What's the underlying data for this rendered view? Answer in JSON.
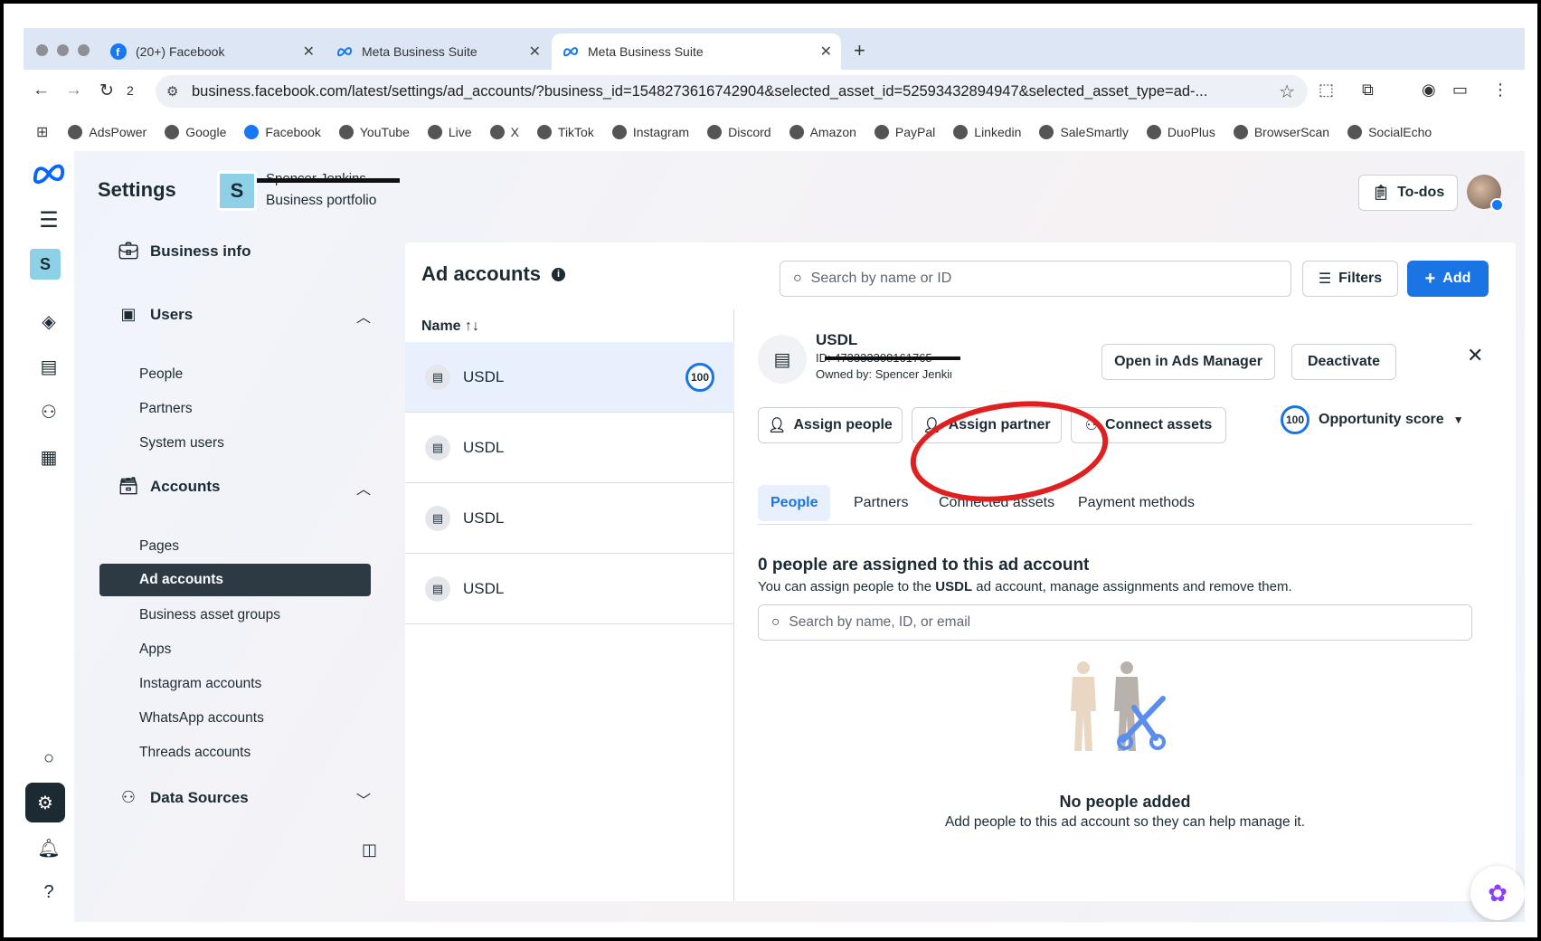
{
  "browser": {
    "tabs": [
      {
        "title": "(20+) Facebook"
      },
      {
        "title": "Meta Business Suite"
      },
      {
        "title": "Meta Business Suite"
      }
    ],
    "reload_count": "2",
    "url": "business.facebook.com/latest/settings/ad_accounts/?business_id=1548273616742904&selected_asset_id=52593432894947&selected_asset_type=ad-...",
    "bookmarks": [
      "AdsPower",
      "Google",
      "Facebook",
      "YouTube",
      "Live",
      "X",
      "TikTok",
      "Instagram",
      "Discord",
      "Amazon",
      "PayPal",
      "Linkedin",
      "SaleSmartly",
      "DuoPlus",
      "BrowserScan",
      "SocialEcho"
    ]
  },
  "header": {
    "title": "Settings",
    "portfolio_initial": "S",
    "portfolio_name": "Spencer Jenkins",
    "portfolio_sub": "Business portfolio",
    "todos": "To-dos"
  },
  "rail": {
    "initial": "S"
  },
  "nav": {
    "business_info": "Business info",
    "users": "Users",
    "users_items": [
      "People",
      "Partners",
      "System users"
    ],
    "accounts": "Accounts",
    "accounts_items": [
      "Pages",
      "Ad accounts",
      "Business asset groups",
      "Apps",
      "Instagram accounts",
      "WhatsApp accounts",
      "Threads accounts"
    ],
    "data_sources": "Data Sources"
  },
  "panel": {
    "title": "Ad accounts",
    "search_placeholder": "Search by name or ID",
    "filters": "Filters",
    "add": "Add",
    "list_header": "Name ↑↓",
    "rows": [
      {
        "name": "USDL",
        "score": "100"
      },
      {
        "name": "USDL"
      },
      {
        "name": "USDL"
      },
      {
        "name": "USDL"
      }
    ]
  },
  "detail": {
    "name": "USDL",
    "id_label": "ID: 473333308161765",
    "owner": "Owned by: Spencer Jenkins",
    "open_ads_manager": "Open in Ads Manager",
    "deactivate": "Deactivate",
    "assign_people": "Assign people",
    "assign_partner": "Assign partner",
    "connect_assets": "Connect assets",
    "opportunity_score_value": "100",
    "opportunity_score": "Opportunity score",
    "tabs": [
      "People",
      "Partners",
      "Connected assets",
      "Payment methods"
    ],
    "heading": "0 people are assigned to this ad account",
    "subtext_pre": "You can assign people to the ",
    "subtext_bold": "USDL",
    "subtext_post": " ad account, manage assignments and remove them.",
    "search_placeholder": "Search by name, ID, or email",
    "empty_title": "No people added",
    "empty_sub": "Add people to this ad account so they can help manage it."
  }
}
